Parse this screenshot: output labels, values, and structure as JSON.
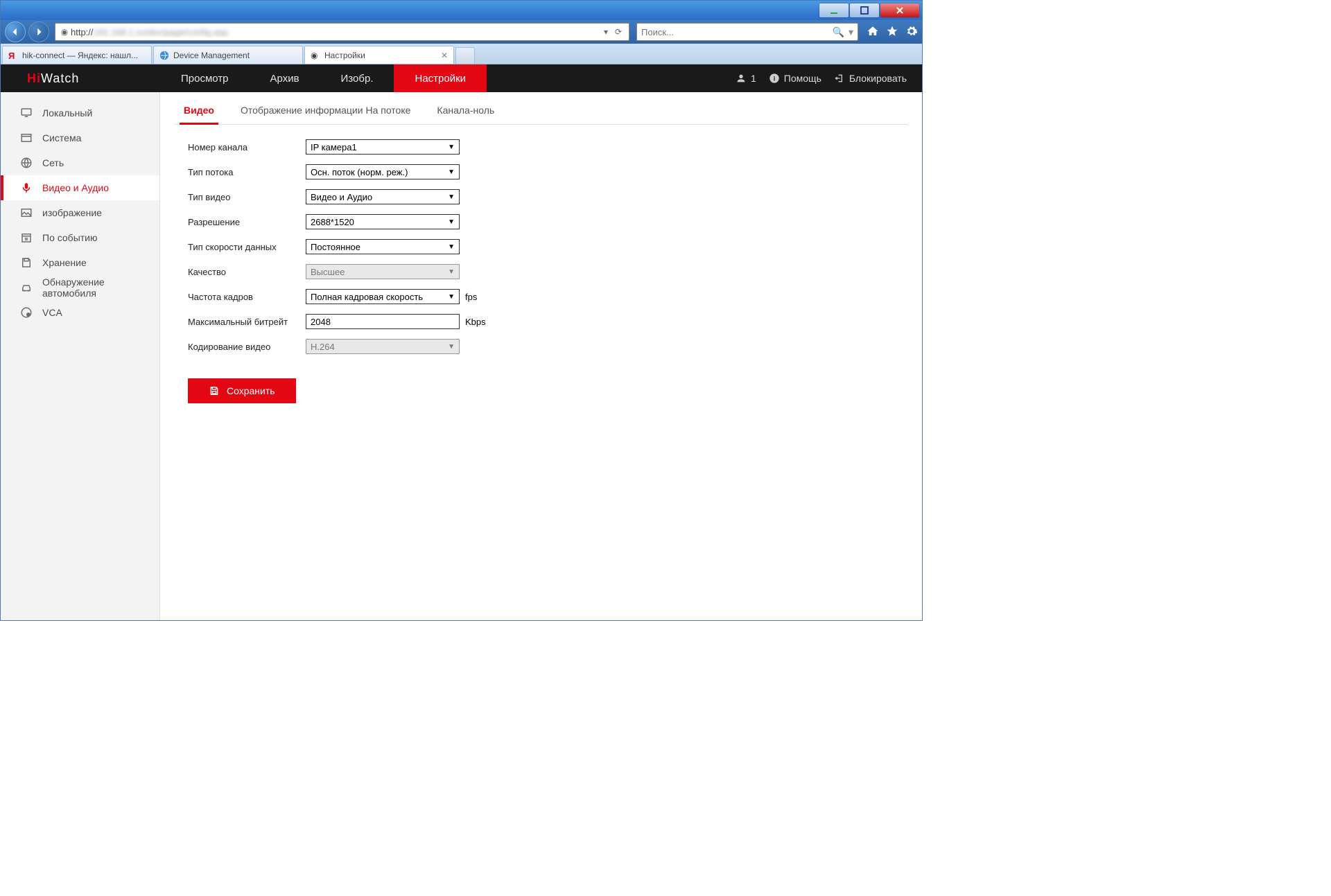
{
  "browser": {
    "url_prefix": "http://",
    "url_blurred": "192.168.1.xx/doc/page/config.asp",
    "search_placeholder": "Поиск...",
    "tabs": [
      {
        "label": "hik-connect — Яндекс: нашл...",
        "active": false,
        "favicon": "yandex"
      },
      {
        "label": "Device Management",
        "active": false,
        "favicon": "ie"
      },
      {
        "label": "Настройки",
        "active": true,
        "favicon": "dot"
      }
    ]
  },
  "logo": {
    "brand_hi": "Hi",
    "brand_watch": "Watch"
  },
  "topnav": [
    {
      "id": "preview",
      "label": "Просмотр"
    },
    {
      "id": "archive",
      "label": "Архив"
    },
    {
      "id": "imagex",
      "label": "Изобр."
    },
    {
      "id": "settings",
      "label": "Настройки",
      "active": true
    }
  ],
  "header_right": {
    "user_count": "1",
    "help": "Помощь",
    "lock": "Блокировать"
  },
  "sidebar": [
    {
      "id": "local",
      "label": "Локальный",
      "icon": "monitor"
    },
    {
      "id": "system",
      "label": "Система",
      "icon": "window"
    },
    {
      "id": "network",
      "label": "Сеть",
      "icon": "globe"
    },
    {
      "id": "videoaudio",
      "label": "Видео и Аудио",
      "icon": "mic",
      "active": true
    },
    {
      "id": "image",
      "label": "изображение",
      "icon": "image"
    },
    {
      "id": "event",
      "label": "По событию",
      "icon": "calendar"
    },
    {
      "id": "storage",
      "label": "Хранение",
      "icon": "save"
    },
    {
      "id": "vehicle",
      "label": "Обнаружение автомобиля",
      "icon": "car"
    },
    {
      "id": "vca",
      "label": "VCA",
      "icon": "vca"
    }
  ],
  "subtabs": [
    {
      "id": "video",
      "label": "Видео",
      "active": true
    },
    {
      "id": "osd",
      "label": "Отображение информации На потоке"
    },
    {
      "id": "zero",
      "label": "Канала-ноль"
    }
  ],
  "form": {
    "channel": {
      "label": "Номер канала",
      "value": "IP камера1"
    },
    "stream_type": {
      "label": "Тип потока",
      "value": "Осн. поток (норм. реж.)"
    },
    "video_type": {
      "label": "Тип видео",
      "value": "Видео и Аудио"
    },
    "resolution": {
      "label": "Разрешение",
      "value": "2688*1520"
    },
    "bitrate_type": {
      "label": "Тип скорости данных",
      "value": "Постоянное"
    },
    "quality": {
      "label": "Качество",
      "value": "Высшее",
      "disabled": true
    },
    "fps": {
      "label": "Частота кадров",
      "value": "Полная кадровая скорость",
      "suffix": "fps"
    },
    "max_bitrate": {
      "label": "Максимальный битрейт",
      "value": "2048",
      "suffix": "Kbps",
      "input": true
    },
    "encoding": {
      "label": "Кодирование видео",
      "value": "H.264",
      "disabled": true
    }
  },
  "save_label": "Сохранить"
}
